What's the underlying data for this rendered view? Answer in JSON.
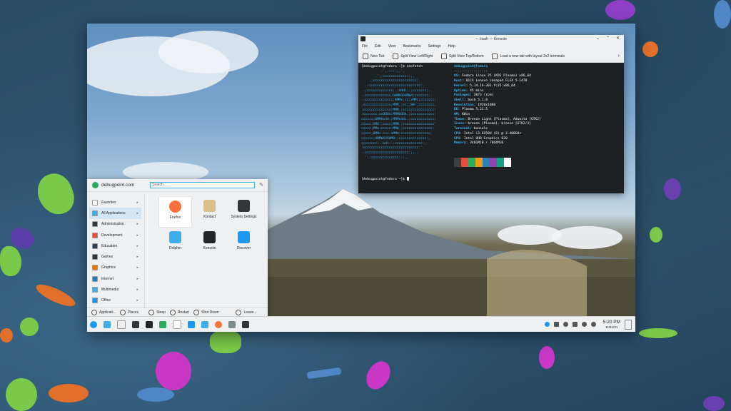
{
  "konsole": {
    "title": "~ : bash — Konsole",
    "menu": [
      "File",
      "Edit",
      "View",
      "Bookmarks",
      "Settings",
      "Help"
    ],
    "toolbar": [
      "New Tab",
      "Split View Left/Right",
      "Split View Top/Bottom",
      "Load a new tab with layout 2x2 terminals"
    ],
    "prompt": "[debugpoint@fedora ~]$ neofetch",
    "prompt2": "[debugpoint@fedora ~]$ ",
    "ascii": "          .',;::::;,'.\n       .';:cccccccccccc:;,.\n    .;cccccccccccccccccccccc;.\n  .:cccccccccccccccccccccccccc:.\n .;ccccccccccccc;.:dddl:.;ccccccc;.\n.:ccccccccccccc;OWMKOOXMWd;ccccccc:.\n.:cccccccccccccc;KMMc;cc;xMMc;ccccccc:.\n,cccccccccccccc;MMM.;cc;;WW:;cccccccc,\n:cccccccccccccc;MMM.;cccccccccccccccc:\n:ccccccc;oxOOOo;MMM0OOk.;cccccccccccc:\ncccccc;0MMKxdd:;MMMkddc.;cccccccccccc;\nccccc;XMO';cccc;MMM.;cccccccccccccccc'\nccccc;MMo;ccccc;MMW.;ccccccccccccccc;\nccccc;0MNc.ccc.xMMd;ccccccccccccccc;\ncccccc;dNMWXXXWM0:;cccccccccccccc:,\ncccccccc;.:odl:.;cccccccccccccc:,.\n:cccccccccccccccccccccccccccc:'.\n.:cccccccccccccccccccccc:;,..\n  '::cccccccccccccc::;,.",
    "user_host": "debugpoint@fedora",
    "separator": "-----------------",
    "info": [
      {
        "key": "OS",
        "value": "Fedora Linux 35 (KDE Plasma) x86_64"
      },
      {
        "key": "Host",
        "value": "81CX Lenovo ideapad FLEX 5-1470"
      },
      {
        "key": "Kernel",
        "value": "5.14.16-301.fc35.x86_64"
      },
      {
        "key": "Uptime",
        "value": "45 mins"
      },
      {
        "key": "Packages",
        "value": "2073 (rpm)"
      },
      {
        "key": "Shell",
        "value": "bash 5.1.8"
      },
      {
        "key": "Resolution",
        "value": "1920x1080"
      },
      {
        "key": "DE",
        "value": "Plasma 5.22.5"
      },
      {
        "key": "WM",
        "value": "KWin"
      },
      {
        "key": "Theme",
        "value": "Breeze Light [Plasma], Adwaita [GTK2]"
      },
      {
        "key": "Icons",
        "value": "breeze [Plasma], breeze [GTK2/3]"
      },
      {
        "key": "Terminal",
        "value": "konsole"
      },
      {
        "key": "CPU",
        "value": "Intel i3-8250U (8) @ 3.400GHz"
      },
      {
        "key": "GPU",
        "value": "Intel UHD Graphics 620"
      },
      {
        "key": "Memory",
        "value": "3401MiB / 7864MiB"
      }
    ],
    "palette": [
      "#3f3f3f",
      "#e74c3c",
      "#27ae60",
      "#f39c12",
      "#2980b9",
      "#8e44ad",
      "#16a085",
      "#fcfcfc"
    ]
  },
  "launcher": {
    "username": "debugpoint.com",
    "search_placeholder": "Search...",
    "categories": [
      {
        "label": "Favorites",
        "color": "#ffffff"
      },
      {
        "label": "All Applications",
        "color": "#3daee9"
      },
      {
        "label": "Administration",
        "color": "#31363b"
      },
      {
        "label": "Development",
        "color": "#e74c3c"
      },
      {
        "label": "Education",
        "color": "#2c3e50"
      },
      {
        "label": "Games",
        "color": "#31363b"
      },
      {
        "label": "Graphics",
        "color": "#f67400"
      },
      {
        "label": "Internet",
        "color": "#2980b9"
      },
      {
        "label": "Multimedia",
        "color": "#3daee9"
      },
      {
        "label": "Office",
        "color": "#1d99f3"
      }
    ],
    "apps": [
      {
        "label": "Firefox",
        "icon": "firefox-icon",
        "color": "#ff7139"
      },
      {
        "label": "Kontact",
        "icon": "kontact-icon",
        "color": "#d9c08a"
      },
      {
        "label": "System Settings",
        "icon": "settings-icon",
        "color": "#31363b"
      },
      {
        "label": "Dolphin",
        "icon": "folder-icon",
        "color": "#3daee9"
      },
      {
        "label": "Konsole",
        "icon": "terminal-icon",
        "color": "#232629"
      },
      {
        "label": "Discover",
        "icon": "discover-icon",
        "color": "#1d99f3"
      }
    ],
    "footer": [
      "Applicati...",
      "Places",
      "Sleep",
      "Restart",
      "Shut Down",
      "Leave..."
    ]
  },
  "taskbar": {
    "time": "5:20 PM",
    "date": "11/11/21"
  }
}
